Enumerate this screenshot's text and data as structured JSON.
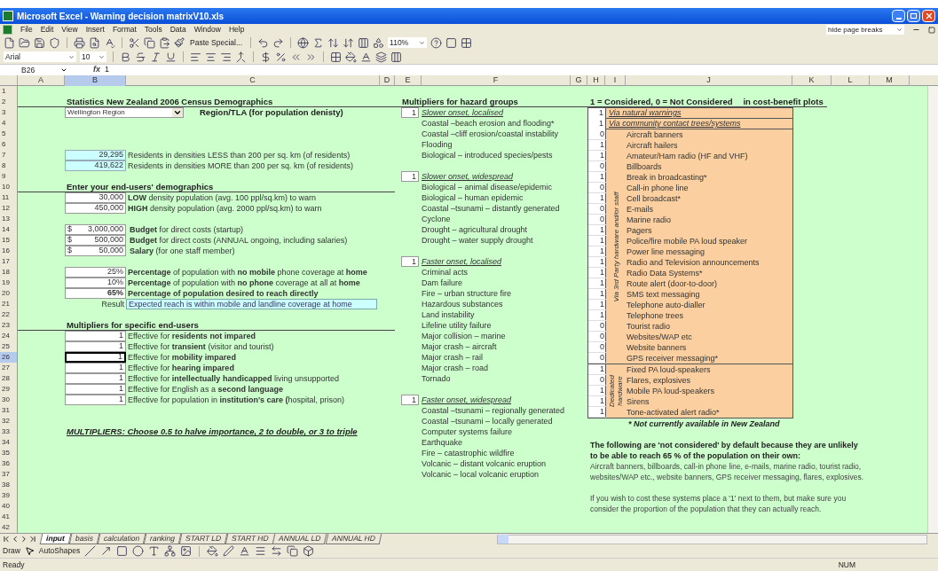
{
  "window": {
    "title": "Microsoft Excel - Warning decision matrixV10.xls"
  },
  "menu": [
    "File",
    "Edit",
    "View",
    "Insert",
    "Format",
    "Tools",
    "Data",
    "Window",
    "Help"
  ],
  "help_box": {
    "value": "hide page breaks"
  },
  "standard_toolbar": {
    "paste_special": "Paste Special...",
    "zoom": "110%"
  },
  "formatting_toolbar": {
    "font": "Arial",
    "size": "10"
  },
  "formula_bar": {
    "name_box": "B26",
    "function_label": "fx",
    "value": "1"
  },
  "columns": [
    {
      "label": "A",
      "selected": false
    },
    {
      "label": "B",
      "selected": true
    },
    {
      "label": "C",
      "selected": false
    },
    {
      "label": "D",
      "selected": false
    },
    {
      "label": "E",
      "selected": false
    },
    {
      "label": "F",
      "selected": false
    },
    {
      "label": "G",
      "selected": false
    },
    {
      "label": "H",
      "selected": false
    },
    {
      "label": "I",
      "selected": false
    },
    {
      "label": "J",
      "selected": false
    },
    {
      "label": "K",
      "selected": false
    },
    {
      "label": "L",
      "selected": false
    },
    {
      "label": "M",
      "selected": false
    }
  ],
  "row_headers": [
    {
      "label": "1",
      "selected": false
    },
    {
      "label": "2",
      "selected": false
    },
    {
      "label": "3",
      "selected": false
    },
    {
      "label": "4",
      "selected": false
    },
    {
      "label": "5",
      "selected": false
    },
    {
      "label": "6",
      "selected": false
    },
    {
      "label": "7",
      "selected": false
    },
    {
      "label": "8",
      "selected": false
    },
    {
      "label": "9",
      "selected": false
    },
    {
      "label": "10",
      "selected": false
    },
    {
      "label": "11",
      "selected": false
    },
    {
      "label": "12",
      "selected": false
    },
    {
      "label": "13",
      "selected": false
    },
    {
      "label": "14",
      "selected": false
    },
    {
      "label": "15",
      "selected": false
    },
    {
      "label": "16",
      "selected": false
    },
    {
      "label": "17",
      "selected": false
    },
    {
      "label": "18",
      "selected": false
    },
    {
      "label": "19",
      "selected": false
    },
    {
      "label": "20",
      "selected": false
    },
    {
      "label": "21",
      "selected": false
    },
    {
      "label": "22",
      "selected": false
    },
    {
      "label": "23",
      "selected": false
    },
    {
      "label": "24",
      "selected": false
    },
    {
      "label": "25",
      "selected": false
    },
    {
      "label": "26",
      "selected": true
    },
    {
      "label": "27",
      "selected": false
    },
    {
      "label": "28",
      "selected": false
    },
    {
      "label": "29",
      "selected": false
    },
    {
      "label": "30",
      "selected": false
    },
    {
      "label": "31",
      "selected": false
    },
    {
      "label": "32",
      "selected": false
    },
    {
      "label": "33",
      "selected": false
    },
    {
      "label": "34",
      "selected": false
    },
    {
      "label": "35",
      "selected": false
    },
    {
      "label": "36",
      "selected": false
    },
    {
      "label": "37",
      "selected": false
    },
    {
      "label": "38",
      "selected": false
    },
    {
      "label": "39",
      "selected": false
    },
    {
      "label": "40",
      "selected": false
    },
    {
      "label": "41",
      "selected": false
    },
    {
      "label": "42",
      "selected": false
    }
  ],
  "census": {
    "title": "Statistics New Zealand 2006 Census Demographics",
    "region": {
      "value": "Wellington Region",
      "label": "Region/TLA (for population denisty)"
    },
    "residents": [
      {
        "value": "29,295",
        "description": "Residents in densities LESS than 200 per sq. km (of residents)"
      },
      {
        "value": "419,622",
        "description": "Residents in densities MORE than 200 per sq. km (of residents)"
      }
    ]
  },
  "demographics": {
    "title": "Enter your end-users' demographics",
    "populations": [
      {
        "value": "30,000",
        "description": "**LOW** density population (avg. 100 ppl/sq.km) to warn"
      },
      {
        "value": "450,000",
        "description": "**HIGH** density population (avg. 2000 ppl/sq.km) to warn"
      }
    ],
    "budgets": [
      {
        "currency": "$",
        "value": "3,000,000",
        "description": "**Budget** for direct costs (startup)"
      },
      {
        "currency": "$",
        "value": "500,000",
        "description": "**Budget** for direct costs (ANNUAL ongoing, including salaries)"
      },
      {
        "currency": "$",
        "value": "50,000",
        "description": "**Salary** (for one staff member)"
      }
    ],
    "percentages": [
      {
        "value": "25%",
        "description": "**Percentage** of population with **no mobile** phone coverage at **home**",
        "bold": false
      },
      {
        "value": "10%",
        "description": "**Percentage** of population with **no phone** coverage at all at **home**",
        "bold": false
      },
      {
        "value": "65%",
        "description": "Percentage of population desired to reach directly",
        "bold": true
      }
    ],
    "result": {
      "label": "Result",
      "value": "Expected reach is within mobile and landline coverage at home"
    }
  },
  "end_user_multipliers": {
    "title": "Multipliers for specific end-users",
    "rows": [
      {
        "value": "1",
        "description": "Effective for **residents not impared**",
        "selected": false
      },
      {
        "value": "1",
        "description": "Effective for **transient** (visitor and tourist)",
        "selected": false
      },
      {
        "value": "1",
        "description": "Effective for **mobility impared**",
        "selected": true
      },
      {
        "value": "1",
        "description": "Effective for **hearing impared**",
        "selected": false
      },
      {
        "value": "1",
        "description": "Effective for **intellectually handicapped** living unsupported",
        "selected": false
      },
      {
        "value": "1",
        "description": "Effective for English as a **second language**",
        "selected": false
      },
      {
        "value": "1",
        "description": "Effective for population in **institution's care (**hospital, prison)",
        "selected": false
      }
    ],
    "note": "MULTIPLIERS: Choose 0.5 to halve importance, 2 to double, or 3 to triple"
  },
  "hazard_groups": {
    "title": "Multipliers for hazard groups",
    "groups": [
      {
        "value": "1",
        "name": "Slower onset, localised",
        "hazards": [
          "Coastal –beach erosion and flooding*",
          "Coastal –cliff erosion/coastal instability",
          "Flooding",
          "Biological – introduced species/pests"
        ]
      },
      {
        "value": "1",
        "name": "Slower onset, widespread",
        "hazards": [
          "Biological – animal disease/epidemic",
          "Biological – human epidemic",
          "Coastal –tsunami – distantly generated",
          "Cyclone",
          "Drought – agricultural drought",
          "Drought – water supply drought"
        ]
      },
      {
        "value": "1",
        "name": "Faster onset, localised",
        "hazards": [
          "Criminal acts",
          "Dam failure",
          "Fire – urban structure fire",
          "Hazardous substances",
          "Land instability",
          "Lifeline utility failure",
          "Major collision – marine",
          "Major crash – aircraft",
          "Major crash – rail",
          "Major crash – road",
          "Tornado"
        ]
      },
      {
        "value": "1",
        "name": "Faster onset, widespread",
        "hazards": [
          "Coastal –tsunami – regionally generated",
          "Coastal –tsunami – locally generated",
          "Computer systems failure",
          "Earthquake",
          "Fire – catastrophic wildfire",
          "Volcanic – distant volcanic eruption",
          "Volcanic – local volcanic eruption"
        ]
      }
    ]
  },
  "warning_systems": {
    "title": "1 = Considered, 0 = Not Considered",
    "subtitle": "in cost-benefit plots",
    "direct": [
      {
        "value": "1",
        "method": "Via natural warnings"
      },
      {
        "value": "1",
        "method": "Via community contact trees/systems"
      }
    ],
    "groups": [
      {
        "label": "Via 3rd Party hardware and/or staff",
        "items": [
          {
            "value": "0",
            "label": "Aircraft banners"
          },
          {
            "value": "1",
            "label": "Aircraft hailers"
          },
          {
            "value": "1",
            "label": "Amateur/Ham radio (HF and VHF)"
          },
          {
            "value": "0",
            "label": "Billboards"
          },
          {
            "value": "1",
            "label": "Break in broadcasting*"
          },
          {
            "value": "0",
            "label": "Call-in phone line"
          },
          {
            "value": "1",
            "label": "Cell broadcast*"
          },
          {
            "value": "0",
            "label": "E-mails"
          },
          {
            "value": "0",
            "label": "Marine radio"
          },
          {
            "value": "1",
            "label": "Pagers"
          },
          {
            "value": "1",
            "label": "Police/fire mobile PA loud speaker"
          },
          {
            "value": "1",
            "label": "Power line messaging"
          },
          {
            "value": "1",
            "label": "Radio and Television announcements"
          },
          {
            "value": "1",
            "label": "Radio Data Systems*"
          },
          {
            "value": "1",
            "label": "Route alert (door-to-door)"
          },
          {
            "value": "1",
            "label": "SMS text messaging"
          },
          {
            "value": "1",
            "label": "Telephone auto-dialler"
          },
          {
            "value": "1",
            "label": "Telephone trees"
          },
          {
            "value": "0",
            "label": "Tourist radio"
          },
          {
            "value": "0",
            "label": "Websites/WAP etc"
          },
          {
            "value": "0",
            "label": "Website banners"
          },
          {
            "value": "0",
            "label": "GPS receiver messaging*"
          }
        ]
      },
      {
        "label": "Dedicated\nhardware",
        "items": [
          {
            "value": "1",
            "label": "Fixed PA loud-speakers"
          },
          {
            "value": "0",
            "label": "Flares, explosives"
          },
          {
            "value": "1",
            "label": "Mobile PA loud-speakers"
          },
          {
            "value": "1",
            "label": "Sirens"
          },
          {
            "value": "1",
            "label": "Tone-activated alert radio*"
          }
        ]
      }
    ],
    "footnote": "* Not currently available in New Zealand",
    "explanation": "The following are 'not considered' by default because they are unlikely\nto be able to reach 65 % of the population on their own:",
    "excluded": "Aircraft banners, billboards, call-in phone line, e-mails, marine radio, tourist radio,\nwebsites/WAP etc., website banners, GPS receiver messaging, flares, explosives.",
    "advice": "If you wish to cost these systems place a '1' next to them, but make sure you\nconsider the proportion of the population that they can actually reach."
  },
  "sheet_tabs": [
    {
      "label": "input",
      "selected": true
    },
    {
      "label": "basis",
      "selected": false
    },
    {
      "label": "calculation",
      "selected": false
    },
    {
      "label": "ranking",
      "selected": false
    },
    {
      "label": "START LD",
      "selected": false
    },
    {
      "label": "START HD",
      "selected": false
    },
    {
      "label": "ANNUAL LD",
      "selected": false
    },
    {
      "label": "ANNUAL HD",
      "selected": false
    }
  ],
  "drawing_toolbar": {
    "draw": "Draw",
    "autoshapes": "AutoShapes"
  },
  "status_bar": {
    "status": "Ready",
    "mode": "NUM"
  }
}
